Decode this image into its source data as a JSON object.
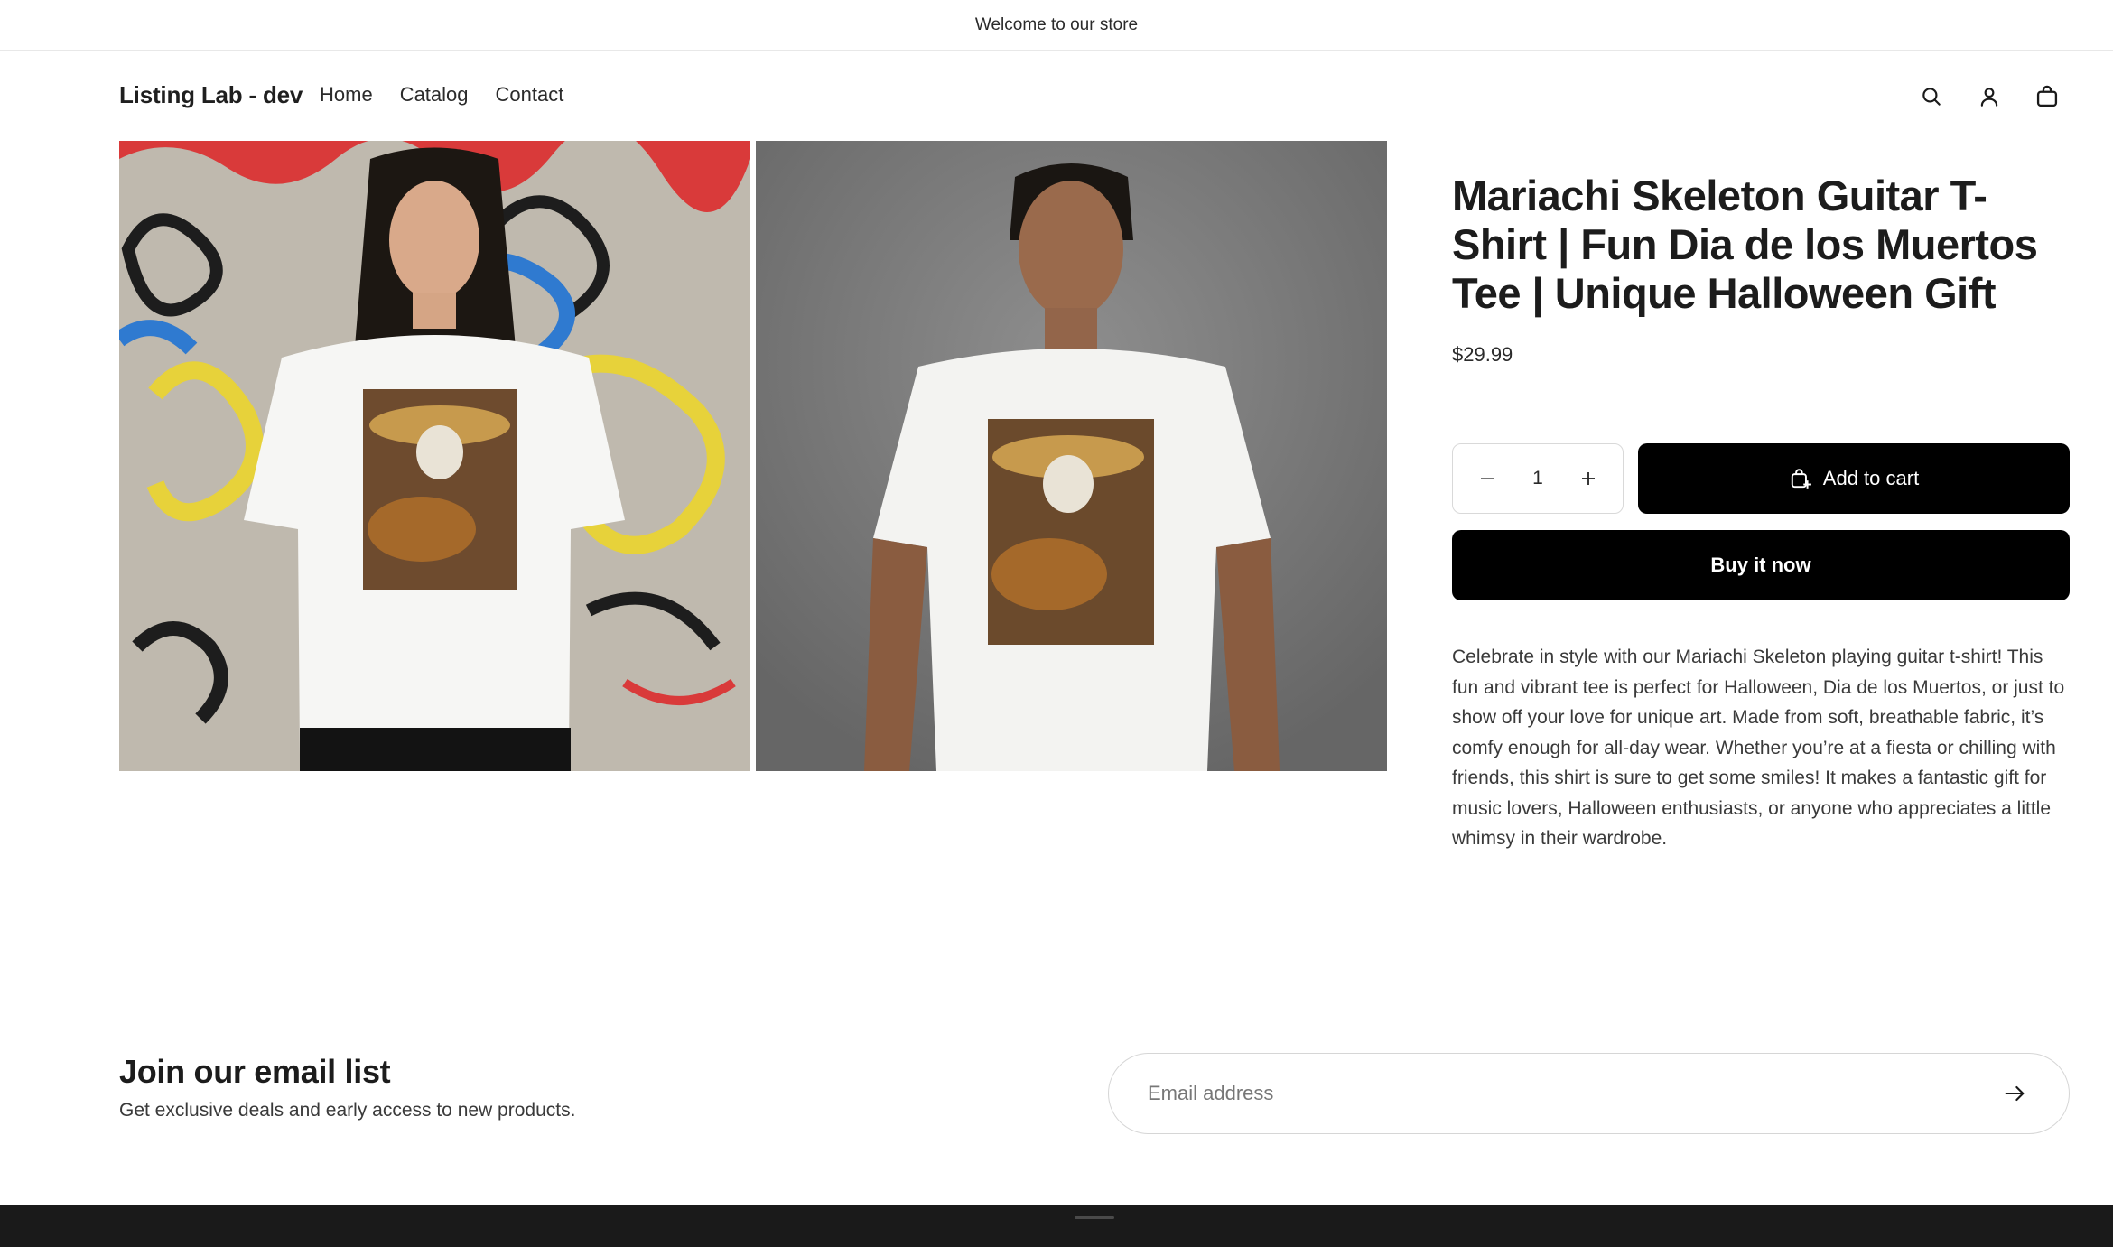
{
  "announcement": {
    "text": "Welcome to our store"
  },
  "header": {
    "logo": "Listing Lab - dev",
    "nav": [
      {
        "label": "Home"
      },
      {
        "label": "Catalog"
      },
      {
        "label": "Contact"
      }
    ],
    "icons": [
      "search-icon",
      "account-icon",
      "cart-icon"
    ]
  },
  "gallery": {
    "images": [
      {
        "name": "product-photo-woman-graffiti"
      },
      {
        "name": "product-photo-man-studio"
      }
    ]
  },
  "product": {
    "title": "Mariachi Skeleton Guitar T-Shirt | Fun Dia de los Muertos Tee | Unique Halloween Gift",
    "price": "$29.99",
    "quantity": "1",
    "add_to_cart_label": "Add to cart",
    "buy_now_label": "Buy it now",
    "description": "Celebrate in style with our Mariachi Skeleton playing guitar t-shirt! This fun and vibrant tee is perfect for Halloween, Dia de los Muertos, or just to show off your love for unique art. Made from soft, breathable fabric, it’s comfy enough for all-day wear. Whether you’re at a fiesta or chilling with friends, this shirt is sure to get some smiles! It makes a fantastic gift for music lovers, Halloween enthusiasts, or anyone who appreciates a little whimsy in their wardrobe."
  },
  "newsletter": {
    "title": "Join our email list",
    "subtitle": "Get exclusive deals and early access to new products.",
    "email_placeholder": "Email address"
  },
  "colors": {
    "primary_button": "#000000",
    "footer": "#1a1a1a"
  }
}
